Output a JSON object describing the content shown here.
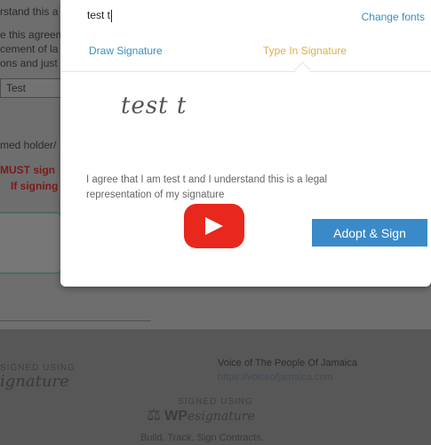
{
  "background": {
    "lines": [
      "rstand this a",
      "e this agreem",
      "cement of la",
      "ons and just"
    ],
    "input_value": "Test",
    "holder_line": "med holder/",
    "warning_line1": "MUST sign",
    "warning_line2_a": "If signing",
    "footer": {
      "signed_using_left": "SIGNED USING",
      "signature_script_left": "ignature",
      "org_name": "Voice of The People Of Jamaica",
      "org_url": "https://voiceofjamaica.com",
      "signed_using_center": "SIGNED USING",
      "logo_wp": "WP",
      "logo_signature": "esignature",
      "tagline": "Build. Track. Sign Contracts."
    }
  },
  "modal": {
    "input_value": "test t",
    "change_fonts": "Change fonts",
    "tab_draw": "Draw Signature",
    "tab_type": "Type In Signature",
    "signature_preview": "test t",
    "legal_text": "I agree that I am test t and I understand this is a legal representation of my signature",
    "adopt_button": "Adopt & Sign"
  },
  "overlay": {
    "play_icon": "youtube-play-icon",
    "play_color": "#e8271d"
  }
}
